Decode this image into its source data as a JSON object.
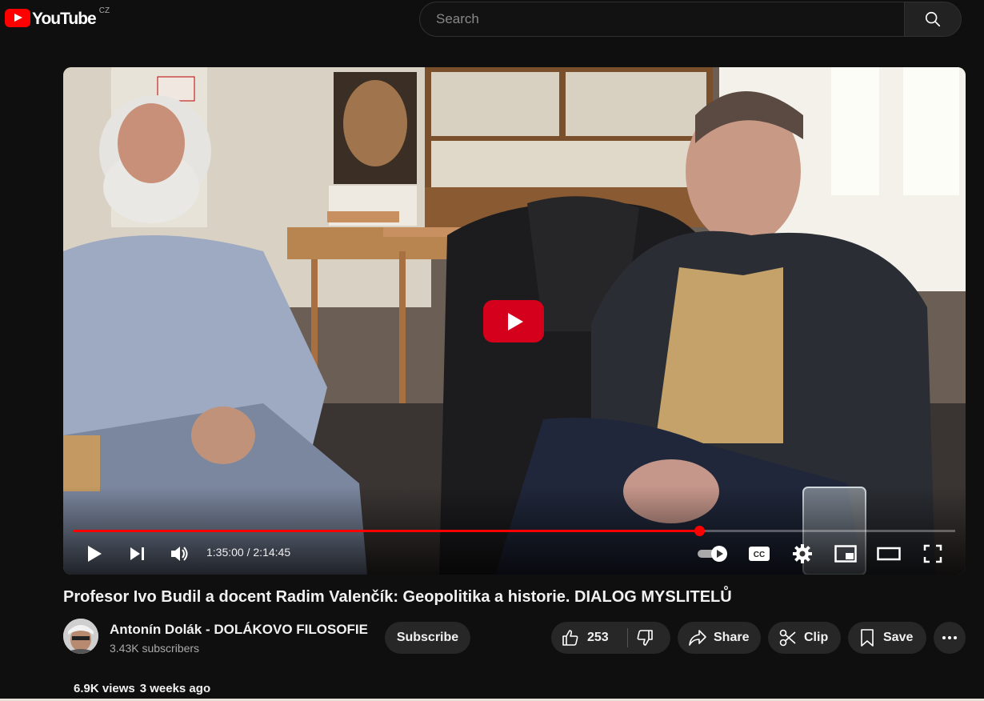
{
  "header": {
    "logo_text": "YouTube",
    "country": "CZ",
    "search_placeholder": "Search"
  },
  "player": {
    "current_time": "1:35:00",
    "separator": " / ",
    "duration": "2:14:45",
    "progress_fraction": 0.71
  },
  "video": {
    "title": "Profesor Ivo Budil a docent Radim Valenčík: Geopolitika a historie. DIALOG MYSLITELŮ",
    "views": "6.9K views",
    "age": "3 weeks ago"
  },
  "channel": {
    "name": "Antonín Dolák - DOLÁKOVO FILOSOFIE",
    "subscribers": "3.43K subscribers",
    "subscribe_label": "Subscribe"
  },
  "actions": {
    "like_count": "253",
    "share_label": "Share",
    "clip_label": "Clip",
    "save_label": "Save"
  },
  "colors": {
    "brand": "#ff0000",
    "background": "#0f0f0f",
    "pill": "#272727"
  }
}
